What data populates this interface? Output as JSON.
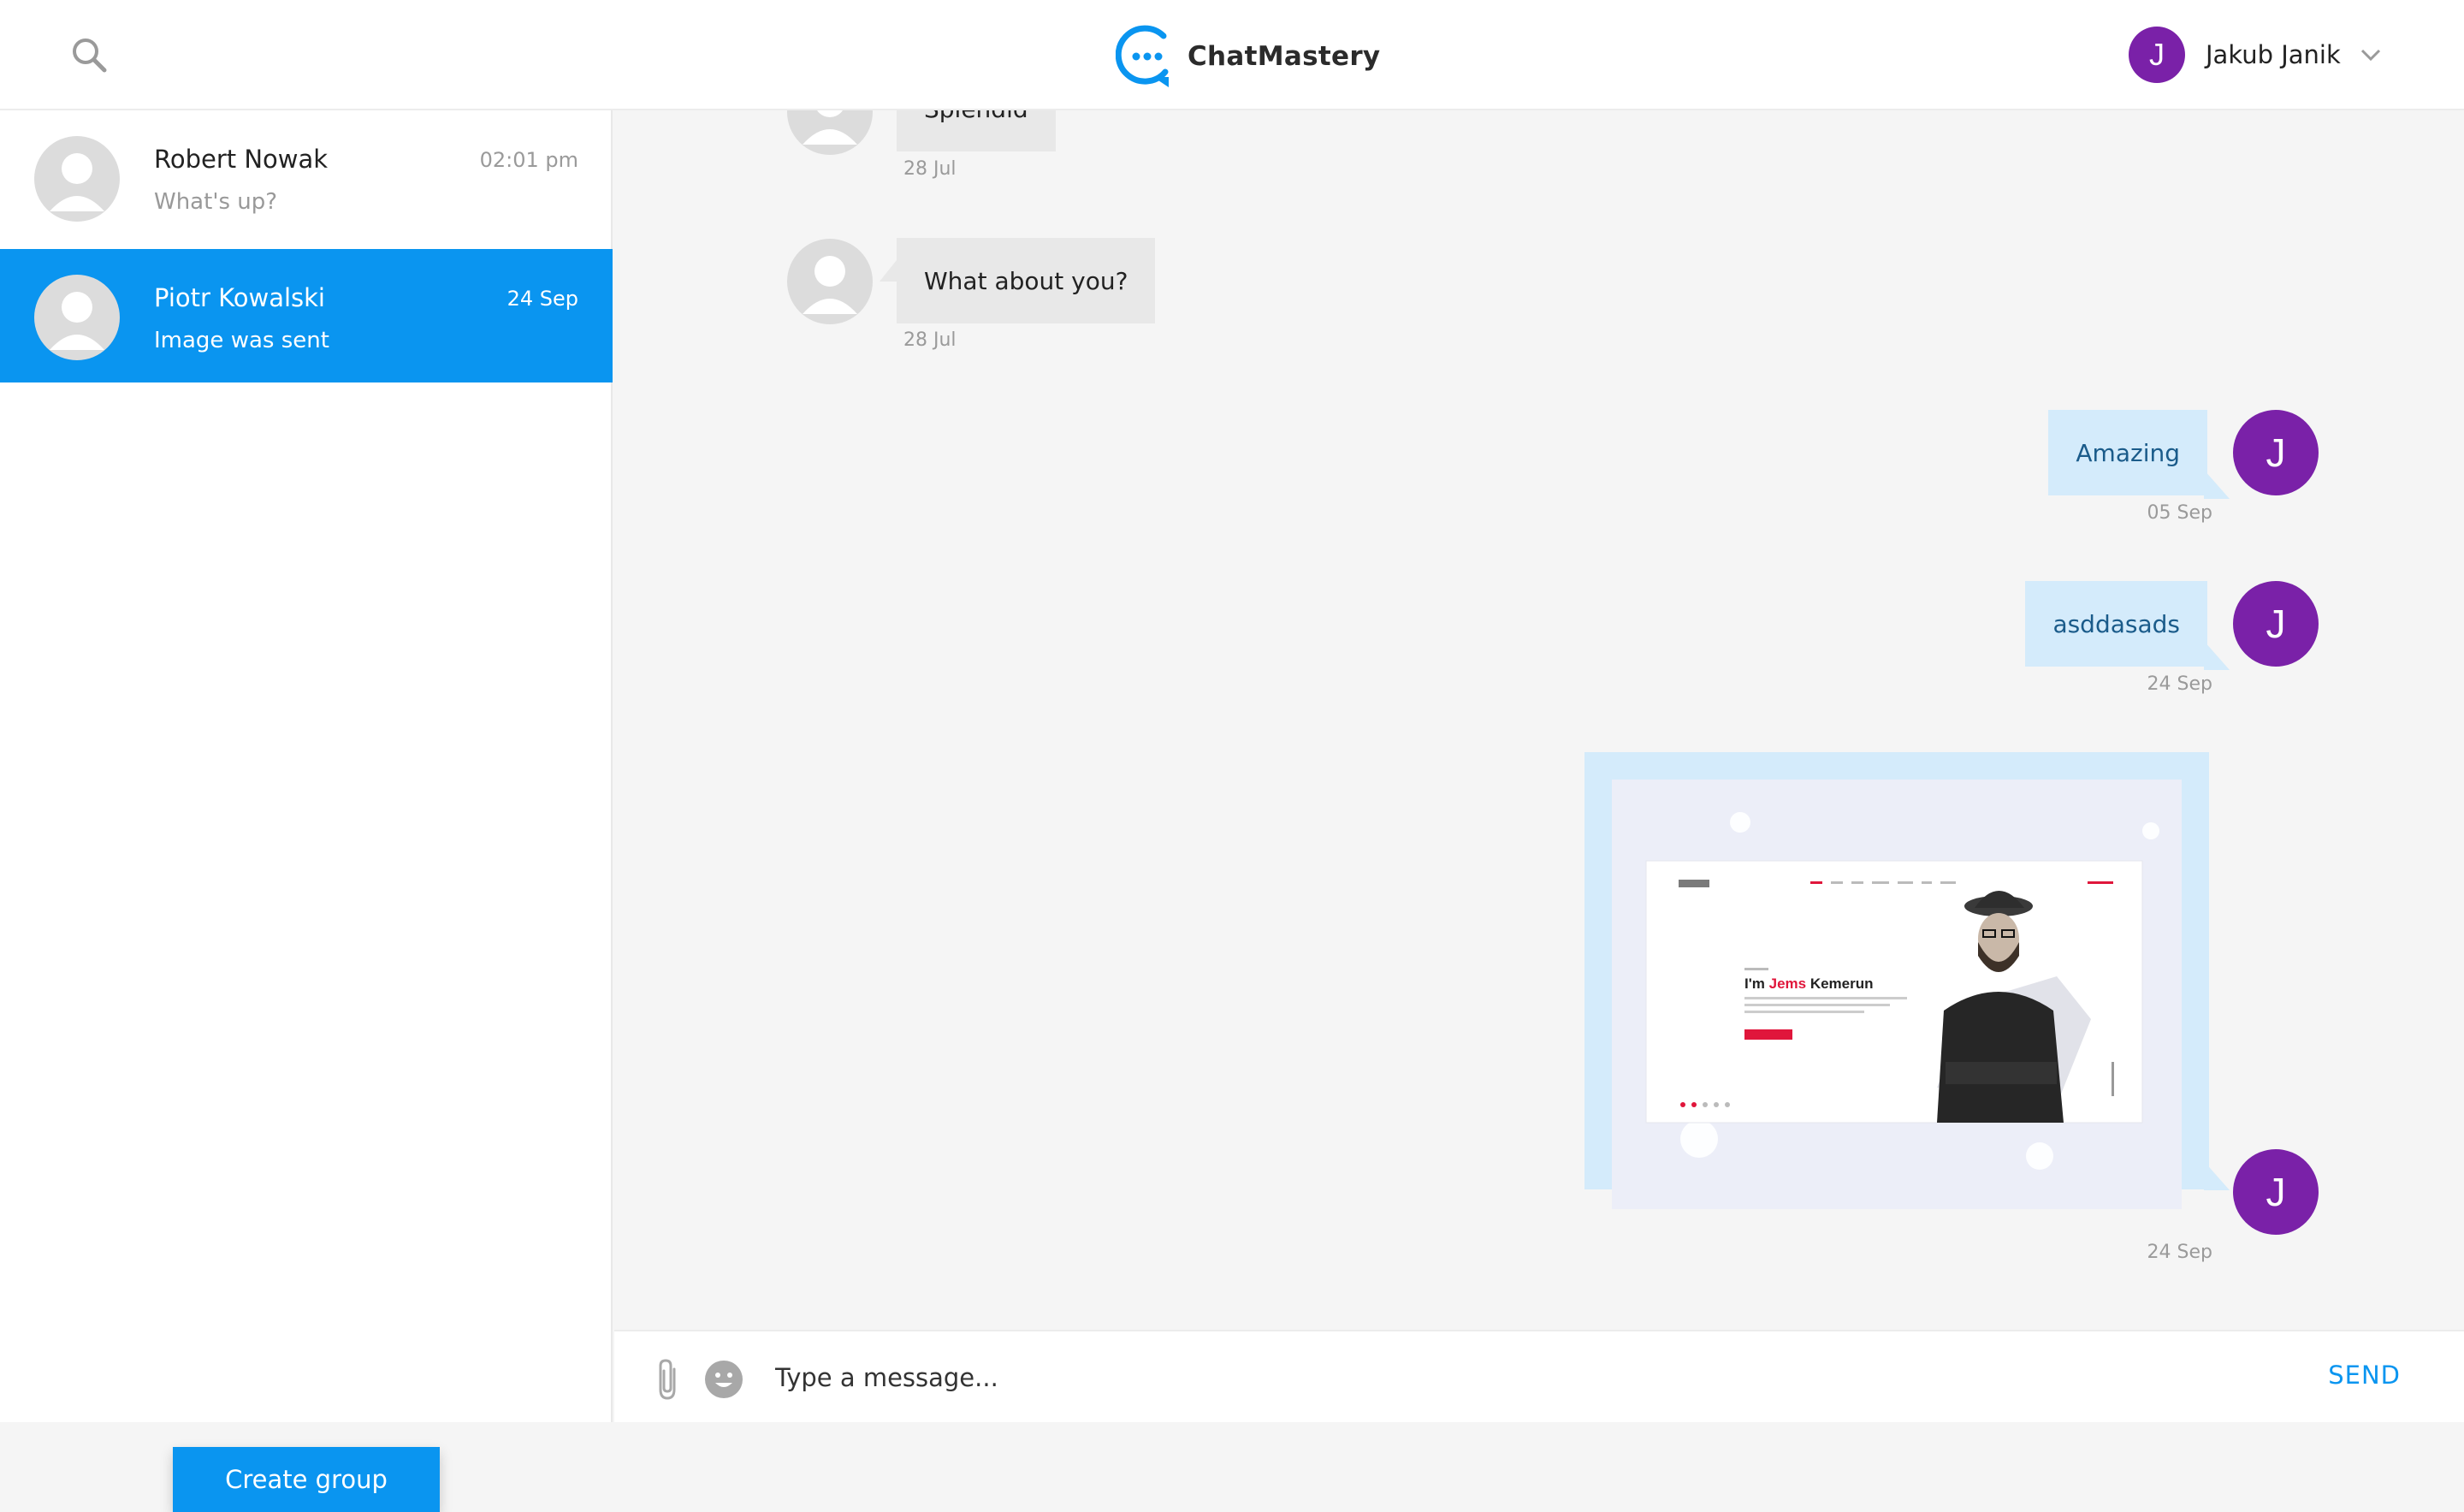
{
  "header": {
    "logo_text": "ChatMastery",
    "user_name": "Jakub Janik",
    "user_initial": "J",
    "icons": [
      "search-icon",
      "chat-logo-icon",
      "chevron-down-icon"
    ]
  },
  "sidebar": {
    "conversations": [
      {
        "name": "Robert Nowak",
        "time": "02:01 pm",
        "preview": "What's up?",
        "active": false
      },
      {
        "name": "Piotr Kowalski",
        "time": "24 Sep",
        "preview": "Image was sent",
        "active": true
      }
    ],
    "create_group_label": "Create group"
  },
  "messages": [
    {
      "direction": "in",
      "text": "Splendid",
      "date": "28 Jul"
    },
    {
      "direction": "in",
      "text": "What about you?",
      "date": "28 Jul"
    },
    {
      "direction": "out",
      "text": "Amazing",
      "date": "05 Sep",
      "initial": "J"
    },
    {
      "direction": "out",
      "text": "asddasads",
      "date": "24 Sep",
      "initial": "J"
    },
    {
      "direction": "out",
      "type": "image",
      "date": "24 Sep",
      "initial": "J",
      "image_text": {
        "prefix": "I'm ",
        "highlight": "Jems",
        "suffix": " Kemerun"
      }
    }
  ],
  "composer": {
    "placeholder": "Type a message...",
    "send_label": "SEND",
    "icons": [
      "paperclip-icon",
      "emoji-icon"
    ]
  },
  "colors": {
    "accent": "#0a95f0",
    "user_avatar": "#7a21a8",
    "outgoing_bubble": "#d4ebfb",
    "incoming_bubble": "#e8e8e8"
  }
}
